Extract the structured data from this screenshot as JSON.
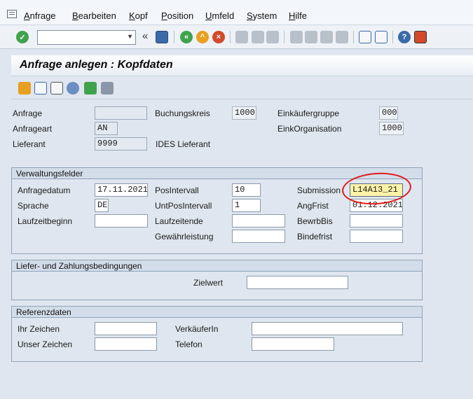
{
  "menu": [
    "Anfrage",
    "Bearbeiten",
    "Kopf",
    "Position",
    "Umfeld",
    "System",
    "Hilfe"
  ],
  "toolbar": {
    "command_value": "",
    "icons": [
      "check-icon",
      "command-dropdown-icon",
      "history-back-icon",
      "save-icon",
      "back-icon",
      "exit-icon",
      "cancel-icon",
      "print-icon",
      "find-icon",
      "find-next-icon",
      "first-page-icon",
      "previous-page-icon",
      "next-page-icon",
      "last-page-icon",
      "create-session-icon",
      "shortcut-icon",
      "help-icon",
      "layout-icon"
    ],
    "prev_symbol": "«"
  },
  "title": "Anfrage anlegen : Kopfdaten",
  "app_toolbar_icons": [
    "overview-icon",
    "edit-icon",
    "texts-icon",
    "partners-icon",
    "flag-icon",
    "print-icon"
  ],
  "header_fields": {
    "anfrage_label": "Anfrage",
    "anfrage_value": "",
    "anfrageart_label": "Anfrageart",
    "anfrageart_value": "AN",
    "lieferant_label": "Lieferant",
    "lieferant_value": "9999",
    "lieferant_name": "IDES Lieferant",
    "buchungskreis_label": "Buchungskreis",
    "buchungskreis_value": "1000",
    "einkaeufergruppe_label": "Einkäufergruppe",
    "einkaeufergruppe_value": "000",
    "einkorganisation_label": "EinkOrganisation",
    "einkorganisation_value": "1000"
  },
  "verwaltung": {
    "title": "Verwaltungsfelder",
    "anfragedatum_label": "Anfragedatum",
    "anfragedatum_value": "17.11.2021",
    "sprache_label": "Sprache",
    "sprache_value": "DE",
    "laufzeitbeginn_label": "Laufzeitbeginn",
    "laufzeitbeginn_value": "",
    "posintervall_label": "PosIntervall",
    "posintervall_value": "10",
    "untposintervall_label": "UntPosIntervall",
    "untposintervall_value": "1",
    "laufzeitende_label": "Laufzeitende",
    "laufzeitende_value": "",
    "gewaehrleistung_label": "Gewährleistung",
    "gewaehrleistung_value": "",
    "submission_label": "Submission",
    "submission_value": "L14A13_21",
    "angfrist_label": "AngFrist",
    "angfrist_value": "01.12.2021",
    "bewrbbis_label": "BewrbBis",
    "bewrbbis_value": "",
    "bindefrist_label": "Bindefrist",
    "bindefrist_value": ""
  },
  "liefer": {
    "title": "Liefer- und Zahlungsbedingungen",
    "zielwert_label": "Zielwert",
    "zielwert_value": ""
  },
  "referenz": {
    "title": "Referenzdaten",
    "ihr_zeichen_label": "Ihr Zeichen",
    "ihr_zeichen_value": "",
    "unser_zeichen_label": "Unser Zeichen",
    "unser_zeichen_value": "",
    "verkaeuferin_label": "VerkäuferIn",
    "verkaeuferin_value": "",
    "telefon_label": "Telefon",
    "telefon_value": ""
  },
  "colors": {
    "annotation": "#e01818",
    "highlight_field": "#fff3a8",
    "background": "#dfe6ef"
  }
}
